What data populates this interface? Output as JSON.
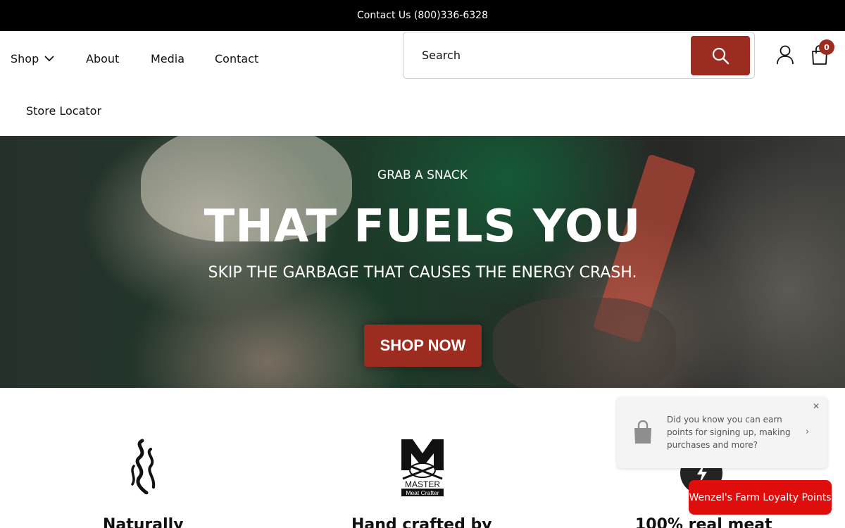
{
  "topbar": {
    "text": "Contact Us (800)336-6328"
  },
  "nav": {
    "items": [
      {
        "label": "Shop"
      },
      {
        "label": "About"
      },
      {
        "label": "Media"
      },
      {
        "label": "Contact"
      },
      {
        "label": "Store Locator"
      }
    ]
  },
  "search": {
    "placeholder": "Search"
  },
  "cart": {
    "count": "0"
  },
  "hero": {
    "kicker": "GRAB A SNACK",
    "title": "THAT FUELS YOU",
    "subtitle": "SKIP THE GARBAGE THAT CAUSES THE ENERGY CRASH.",
    "button_label": "SHOP NOW"
  },
  "features": [
    {
      "title": "Naturally",
      "icon": "smoke-icon"
    },
    {
      "title": "Hand crafted by",
      "icon": "master-meat-crafter-logo"
    },
    {
      "title": "100% real meat",
      "icon": "energy-bolt-icon"
    }
  ],
  "logo_text": {
    "line1": "MASTER",
    "line2": "Meat Crafter"
  },
  "popup": {
    "text": "Did you know you can earn points for signing up, making purchases and more?"
  },
  "loyalty": {
    "label": "Wenzel's Farm Loyalty Points"
  },
  "colors": {
    "brand": "#9b2c1f",
    "loyalty": "#e00d0d",
    "topbar": "#000000"
  }
}
